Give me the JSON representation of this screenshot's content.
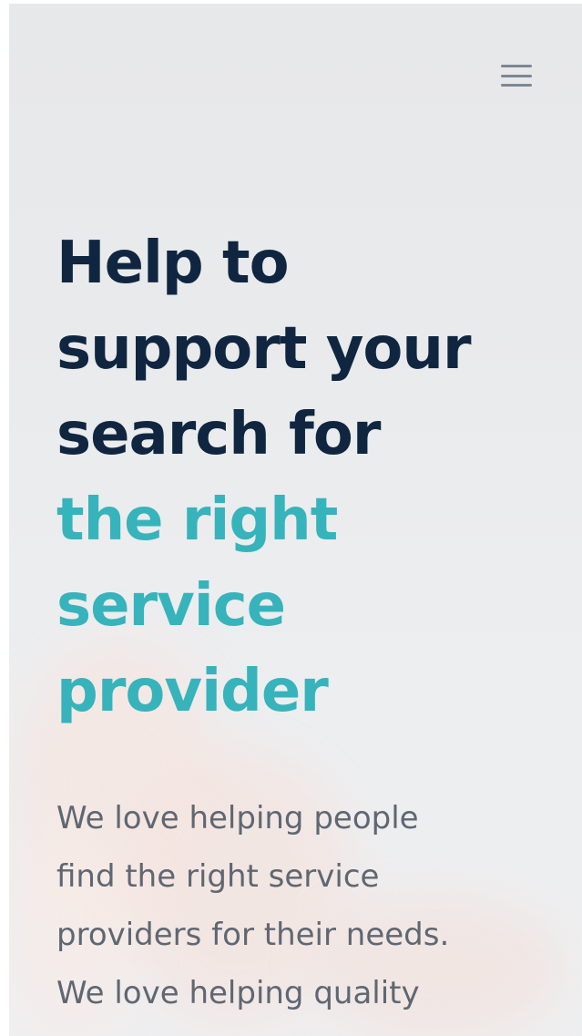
{
  "header": {
    "menu_icon": "hamburger-menu-icon"
  },
  "hero": {
    "headline": {
      "line1": "Help to",
      "line2": "support your",
      "line3": "search for",
      "accent_line1": "the right",
      "accent_line2": "service",
      "accent_line3": "provider"
    },
    "body": {
      "line1": "We love helping people",
      "line2": "find the right service",
      "line3": "providers for their needs.",
      "line4": "We love helping quality"
    }
  },
  "colors": {
    "heading": "#102640",
    "accent": "#37b3bb",
    "body_text": "#5f6772",
    "icon": "#7e8794",
    "background": "#e9eaec"
  }
}
